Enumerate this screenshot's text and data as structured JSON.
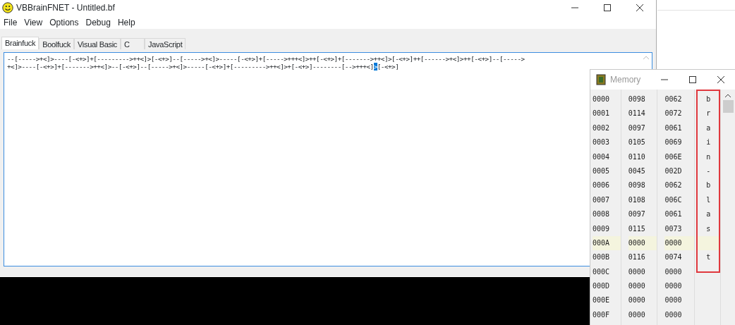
{
  "window": {
    "title": "VBBrainFNET - Untitled.bf"
  },
  "menu": [
    "File",
    "View",
    "Options",
    "Debug",
    "Help"
  ],
  "tabs": [
    {
      "label": "Brainfuck",
      "selected": true
    },
    {
      "label": "Boolfuck",
      "selected": false
    },
    {
      "label": "Visual Basic",
      "selected": false
    },
    {
      "label": "C",
      "selected": false
    },
    {
      "label": "JavaScript",
      "selected": false
    }
  ],
  "editor": {
    "lines": [
      {
        "segments": [
          {
            "text": "--[----->+<]>----[-<+>]+[--------->++<]>[-<+>]--[----->+<]>-----[-<+>]+[----->+++<]>++[-<+>]+[------->++<]>[-<+>]++[------>+<]>++[-<+>]--[----->",
            "selected": false
          }
        ]
      },
      {
        "segments": [
          {
            "text": "+<]>----[-<+>]+[------->++<]>--[-<+>]--[----->+<]>-----[-<+>]+[--------->++<]>+[-<+>]--------[-->+++<]",
            "selected": false
          },
          {
            "text": ">",
            "selected": true
          },
          {
            "text": "[-<+>]",
            "selected": false
          }
        ]
      }
    ]
  },
  "memory": {
    "title": "Memory",
    "rows": [
      {
        "address": "0000",
        "dec": "0098",
        "hex": "0062",
        "char": "b",
        "highlighted": false
      },
      {
        "address": "0001",
        "dec": "0114",
        "hex": "0072",
        "char": "r",
        "highlighted": false
      },
      {
        "address": "0002",
        "dec": "0097",
        "hex": "0061",
        "char": "a",
        "highlighted": false
      },
      {
        "address": "0003",
        "dec": "0105",
        "hex": "0069",
        "char": "i",
        "highlighted": false
      },
      {
        "address": "0004",
        "dec": "0110",
        "hex": "006E",
        "char": "n",
        "highlighted": false
      },
      {
        "address": "0005",
        "dec": "0045",
        "hex": "002D",
        "char": "-",
        "highlighted": false
      },
      {
        "address": "0006",
        "dec": "0098",
        "hex": "0062",
        "char": "b",
        "highlighted": false
      },
      {
        "address": "0007",
        "dec": "0108",
        "hex": "006C",
        "char": "l",
        "highlighted": false
      },
      {
        "address": "0008",
        "dec": "0097",
        "hex": "0061",
        "char": "a",
        "highlighted": false
      },
      {
        "address": "0009",
        "dec": "0115",
        "hex": "0073",
        "char": "s",
        "highlighted": false
      },
      {
        "address": "000A",
        "dec": "0000",
        "hex": "0000",
        "highlighted": true
      },
      {
        "address": "000B",
        "dec": "0116",
        "hex": "0074",
        "char": "t",
        "highlighted": false
      },
      {
        "address": "000C",
        "dec": "0000",
        "hex": "0000",
        "highlighted": false
      },
      {
        "address": "000D",
        "dec": "0000",
        "hex": "0000",
        "highlighted": false
      },
      {
        "address": "000E",
        "dec": "0000",
        "hex": "0000",
        "highlighted": false
      },
      {
        "address": "000F",
        "dec": "0000",
        "hex": "0000",
        "highlighted": false
      }
    ]
  }
}
